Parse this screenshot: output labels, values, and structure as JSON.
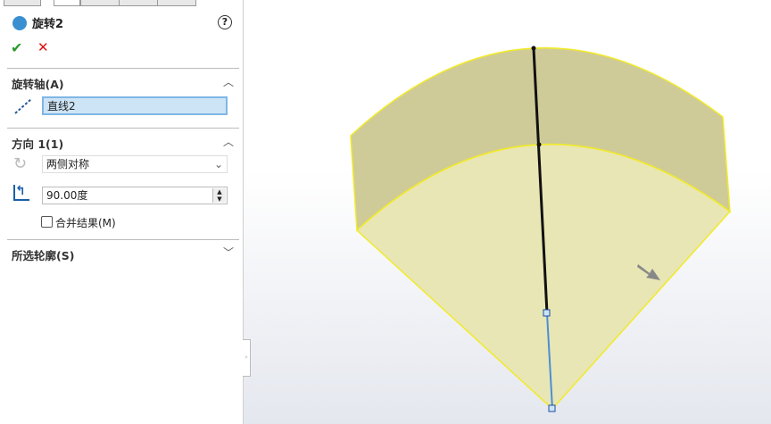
{
  "feature": {
    "title": "旋转2",
    "help": "?",
    "ok": "✔",
    "cancel": "✕"
  },
  "axis_section": {
    "title": "旋转轴(A)",
    "value": "直线2"
  },
  "direction_section": {
    "title": "方向 1(1)",
    "type": "两侧对称",
    "angle": "90.00度",
    "merge_label": "合并结果(M)",
    "merge_checked": false
  },
  "profile_section": {
    "title": "所选轮廓(S)"
  },
  "colors": {
    "face": "#e6e4a8",
    "edge": "#f0e830",
    "axis": "#111111",
    "sketch": "#4a8ed8"
  }
}
